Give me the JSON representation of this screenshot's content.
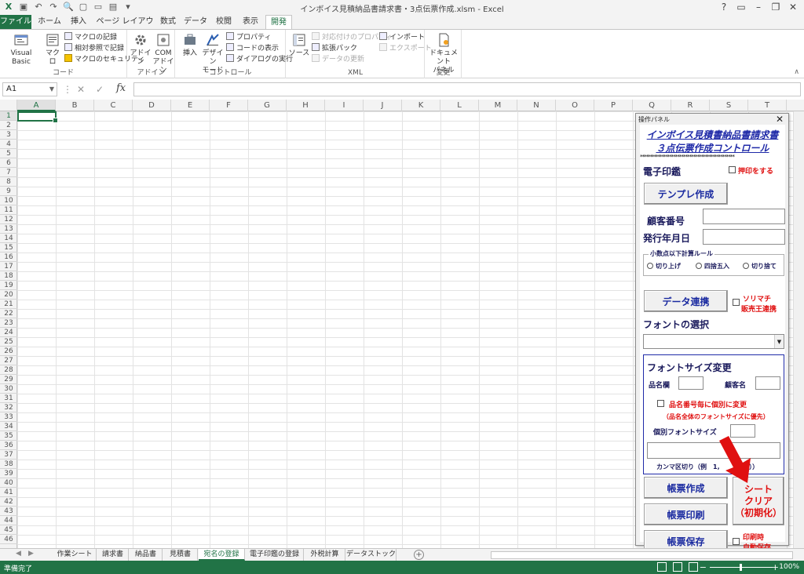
{
  "window": {
    "title": "インボイス見積納品書請求書・3点伝票作成.xlsm - Excel"
  },
  "ribbon": {
    "tabs": [
      "ファイル",
      "ホーム",
      "挿入",
      "ページ レイアウト",
      "数式",
      "データ",
      "校閲",
      "表示",
      "開発"
    ],
    "active_tab": "開発",
    "groups": {
      "code": {
        "label": "コード",
        "visual_basic": "Visual Basic",
        "macro": "マクロ",
        "record_macro": "マクロの記録",
        "relative_ref": "相対参照で記録",
        "macro_security": "マクロのセキュリティ"
      },
      "addins": {
        "label": "アドイン",
        "addin": "アドイン",
        "com_addin_line1": "COM",
        "com_addin_line2": "アドイン"
      },
      "controls": {
        "label": "コントロール",
        "insert": "挿入",
        "design_mode_line1": "デザイン",
        "design_mode_line2": "モード",
        "properties": "プロパティ",
        "view_code": "コードの表示",
        "run_dialog": "ダイアログの実行"
      },
      "xml": {
        "label": "XML",
        "source": "ソース",
        "map_properties": "対応付けのプロパティ",
        "expansion_packs": "拡張パック",
        "refresh_data": "データの更新",
        "import": "インポート",
        "export": "エクスポート"
      },
      "modify": {
        "label": "変更",
        "doc_panel_line1": "ドキュメント",
        "doc_panel_line2": "パネル"
      }
    }
  },
  "formula_bar": {
    "name_box": "A1",
    "fx": "fx",
    "value": ""
  },
  "grid": {
    "columns": [
      "A",
      "B",
      "C",
      "D",
      "E",
      "F",
      "G",
      "H",
      "I",
      "J",
      "K",
      "L",
      "M",
      "N",
      "O",
      "P",
      "Q",
      "R",
      "S",
      "T"
    ],
    "rows": [
      "1",
      "2",
      "3",
      "4",
      "5",
      "6",
      "7",
      "8",
      "9",
      "10",
      "11",
      "12",
      "13",
      "14",
      "15",
      "16",
      "17",
      "18",
      "19",
      "20",
      "21",
      "22",
      "23",
      "24",
      "25",
      "26",
      "27",
      "28",
      "29",
      "30",
      "31",
      "32",
      "33",
      "34",
      "35",
      "36",
      "37",
      "38",
      "39",
      "40",
      "41",
      "42",
      "43",
      "44",
      "45",
      "46"
    ],
    "selected_cell": "A1"
  },
  "sheet_tabs": [
    "作業シート",
    "請求書",
    "納品書",
    "見積書",
    "宛名の登録",
    "電子印鑑の登録",
    "外税計算",
    "データストック"
  ],
  "active_sheet": "宛名の登録",
  "status": {
    "ready": "準備完了",
    "zoom": "100%"
  },
  "panel": {
    "window_title": "操作パネル",
    "heading1": "インボイス見積書納品書請求書",
    "heading2": "３点伝票作成コントロール",
    "stars": "************************************************",
    "e_seal_label": "電子印鑑",
    "stamp_check_label": "押印をする",
    "template_button": "テンプレ作成",
    "customer_no_label": "顧客番号",
    "customer_no_value": "",
    "issue_date_label": "発行年月日",
    "issue_date_value": "",
    "rounding_legend": "小数点以下計算ルール",
    "rounding_options": [
      "切り上げ",
      "四捨五入",
      "切り捨て"
    ],
    "data_link_button": "データ連携",
    "sorimachi_line1": "ソリマチ",
    "sorimachi_line2": "販売王連携",
    "font_select_label": "フォントの選択",
    "font_select_value": "",
    "font_size_heading": "フォントサイズ変更",
    "item_name_label": "品名欄",
    "customer_name_label": "顧客名",
    "individual_check_label": "品名番号毎に個別に変更",
    "priority_note": "（品名全体のフォントサイズに優先）",
    "individual_size_label": "個別フォントサイズ",
    "comma_note": "カンマ区切り（例　1,　　　　7））",
    "create_button": "帳票作成",
    "print_button": "帳票印刷",
    "save_button": "帳票保存",
    "clear_line1": "シート",
    "clear_line2": "クリア",
    "clear_line3": "（初期化）",
    "autosave_line1": "印刷時",
    "autosave_line2": "自動保存"
  },
  "colors": {
    "excel_green": "#217346",
    "panel_blue": "#1f2aa8",
    "panel_red": "#e01010",
    "arrow_red": "#e01010"
  }
}
